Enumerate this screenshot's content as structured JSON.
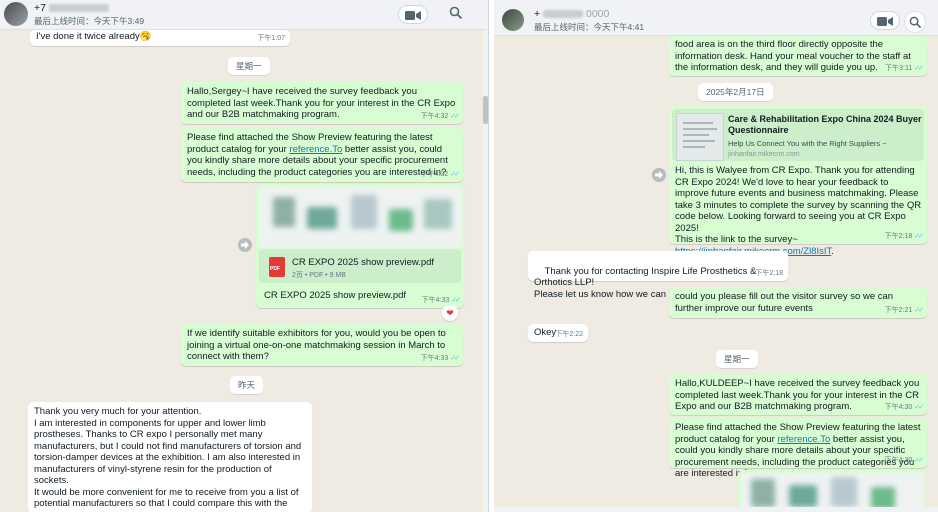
{
  "left_chat": {
    "header": {
      "name": "+7",
      "status": "最后上线时间：今天下午3:49"
    },
    "messages": {
      "m1": {
        "text": "I've done it twice already🥱",
        "time": "下午1:07"
      },
      "date1": "星期一",
      "m2": {
        "text": "Hallo,Sergey~I have received the survey feedback you completed last week.Thank you for your interest in the CR Expo and our B2B matchmaking program.",
        "time": "下午4:32"
      },
      "m3": {
        "text_before": "Please find attached the Show Preview featuring the latest product catalog for your ",
        "link": "reference.To",
        "text_after": " better assist you, could you kindly share more details about your specific procurement needs, including the product categories you are interested in?",
        "time": "下午4:32"
      },
      "m4": {
        "file_name": "CR EXPO 2025 show preview.pdf",
        "file_meta": "2页 • PDF • 9 MB",
        "caption": "CR EXPO 2025 show preview.pdf",
        "time": "下午4:33",
        "reaction": "❤"
      },
      "m5": {
        "text": "If we identify suitable exhibitors for you, would you be open to joining a virtual one-on-one matchmaking session in March to connect with them?",
        "time": "下午4:33"
      },
      "date2": "昨天",
      "m6": {
        "text": "Thank you very much for your attention.\nI am interested in components for upper and lower limb prostheses. Thanks to CR expo I personally met many manufacturers, but I could not find manufacturers of torsion and torsion-damper devices at the exhibition. I am also interested in manufacturers of vinyl-styrene resin for the production of sockets.\nIt would be more convenient for me to receive from you a list of potential manufacturers so that I could compare this with the"
      }
    }
  },
  "right_chat": {
    "header": {
      "name": "+",
      "name_tail": "0000",
      "status": "最后上线时间：今天下午4:41"
    },
    "messages": {
      "r1": {
        "text": "food area is on the third floor directly opposite the information desk. Hand your meal voucher to the staff at the information desk, and they will guide you up.",
        "time": "下午3:11"
      },
      "date1": "2025年2月17日",
      "r2": {
        "preview_title": "Care & Rehabilitation Expo China 2024 Buyer Questionnaire",
        "preview_desc": "Help Us Connect You with the Right Suppliers ~",
        "preview_url": "jinhanfair.mikecrm.com",
        "text": "Hi, this is Walyee from CR Expo. Thank you for attending CR Expo 2024! We'd love to hear your feedback to improve future events and business matchmaking. Please take 3 minutes to complete the survey by scanning the QR code below. Looking forward to seeing you at CR Expo 2025!\nThis is the link to the survey~",
        "link": "https://jinhanfair.mikecrm.com/Zl8IsIT",
        "link_suffix": ".",
        "time": "下午2:18"
      },
      "r3": {
        "text": "Thank you for contacting Inspire Life Prosthetics & Orthotics LLP!\nPlease let us know how we can help you.",
        "time": "下午2:18"
      },
      "r4": {
        "text": "could you please fill out the visitor survey so we can further improve our future events",
        "time": "下午2:21"
      },
      "r5": {
        "text": "Okey",
        "time": "下午2:22"
      },
      "date2": "星期一",
      "r6": {
        "text": "Hallo,KULDEEP~I have received the survey feedback you completed last week.Thank you for your interest in the CR Expo and our B2B matchmaking program.",
        "time": "下午4:30"
      },
      "r7": {
        "text_before": "Please find attached the Show Preview featuring the latest product catalog for your ",
        "link": "reference.To",
        "text_after": " better assist you, could you kindly share more details about your specific procurement needs, including the product categories you are interested in?",
        "time": "下午4:30"
      }
    }
  },
  "colors": {
    "outgoing": "#d9fdd3",
    "incoming": "#ffffff",
    "chat_bg": "#efeae2",
    "header_bg": "#f0f2f5",
    "tick": "#53bdeb",
    "link": "#027eb5"
  },
  "icons": [
    "video-call-icon",
    "search-icon",
    "forward-icon",
    "pdf-file-icon",
    "read-receipt-icon",
    "heart-reaction-icon",
    "avatar"
  ]
}
